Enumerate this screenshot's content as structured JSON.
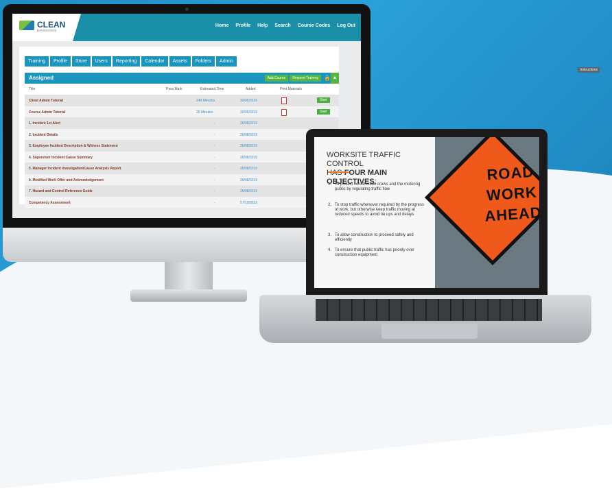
{
  "monitor": {
    "brand": "CLEAN",
    "brand_sub": "Environment",
    "nav": [
      "Home",
      "Profile",
      "Help",
      "Search",
      "Course Codes",
      "Log Out"
    ],
    "tabs": [
      "Training",
      "Profile",
      "Store",
      "Users",
      "Reporting",
      "Calendar",
      "Assets",
      "Folders",
      "Admin"
    ],
    "instructions_label": "Instructions",
    "section_title": "Assigned",
    "add_course": "Add Course",
    "request_training": "Request Training",
    "columns": [
      "Title",
      "Pass Mark",
      "Estimated Time",
      "Added",
      "Print Materials"
    ],
    "rows": [
      {
        "title": "Client Admin Tutorial",
        "est": "240 Minutes",
        "added": "30/05/2019",
        "pdf": true,
        "start": "Start"
      },
      {
        "title": "Course Admin Tutorial",
        "est": "20 Minutes",
        "added": "30/05/2019",
        "pdf": true,
        "start": "Start"
      },
      {
        "title": "1. Incident 1st Alert",
        "est": "",
        "added": "26/08/2019",
        "pdf": false,
        "start": ""
      },
      {
        "title": "2. Incident Details",
        "est": "",
        "added": "26/08/2019",
        "pdf": false,
        "start": ""
      },
      {
        "title": "3. Employee Incident Description & Witness Statement",
        "est": "",
        "added": "26/08/2019",
        "pdf": false,
        "start": ""
      },
      {
        "title": "4. Supervisor Incident Cause Summary",
        "est": "",
        "added": "26/08/2019",
        "pdf": false,
        "start": ""
      },
      {
        "title": "5. Manager Incident Investigation/Cause Analysis Report",
        "est": "",
        "added": "26/08/2019",
        "pdf": false,
        "start": ""
      },
      {
        "title": "6. Modified Work Offer and Acknowledgement",
        "est": "",
        "added": "26/08/2019",
        "pdf": false,
        "start": ""
      },
      {
        "title": "7. Hazard and Control Reference Guide",
        "est": "",
        "added": "26/08/2019",
        "pdf": false,
        "start": ""
      },
      {
        "title": "Competency Assessment",
        "est": "",
        "added": "07/10/2019",
        "pdf": false,
        "start": ""
      }
    ]
  },
  "laptop": {
    "title_line1": "WORKSITE TRAFFIC CONTROL",
    "title_prefix": "HAS ",
    "title_bold": "FOUR MAIN OBJECTIVES",
    "title_suffix": ":",
    "objectives": [
      {
        "n": "1.",
        "text": "To protect construction crews and the motoring public by regulating traffic flow"
      },
      {
        "n": "2.",
        "text": "To stop traffic whenever required by the progress of work, but otherwise keep traffic moving at reduced speeds to avoid tie ups and delays"
      },
      {
        "n": "3.",
        "text": "To allow construction to proceed safely and efficiently"
      },
      {
        "n": "4.",
        "text": "To ensure that public traffic has priority over construction equipment"
      }
    ],
    "sign_text": [
      "ROAD",
      "WORK",
      "AHEAD"
    ]
  }
}
